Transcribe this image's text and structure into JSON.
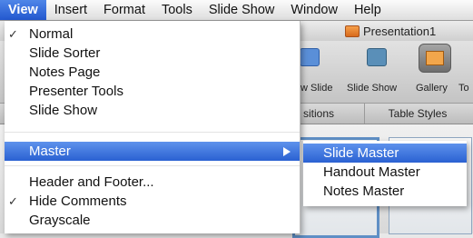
{
  "menubar": {
    "items": [
      "View",
      "Insert",
      "Format",
      "Tools",
      "Slide Show",
      "Window",
      "Help"
    ]
  },
  "app": {
    "document_title": "Presentation1",
    "toolbar": {
      "new_slide_label": "w Slide",
      "slide_show_label": "Slide Show",
      "gallery_label": "Gallery",
      "truncated_label": "To"
    },
    "ribbon_tabs": [
      "sitions",
      "Table Styles"
    ]
  },
  "view_menu": {
    "items": [
      {
        "label": "Normal",
        "checked": "✓"
      },
      {
        "label": "Slide Sorter",
        "checked": ""
      },
      {
        "label": "Notes Page",
        "checked": ""
      },
      {
        "label": "Presenter Tools",
        "checked": ""
      },
      {
        "label": "Slide Show",
        "checked": ""
      },
      {
        "label": "Master",
        "checked": ""
      },
      {
        "label": "Header and Footer...",
        "checked": ""
      },
      {
        "label": "Hide Comments",
        "checked": "✓"
      },
      {
        "label": "Grayscale",
        "checked": ""
      }
    ]
  },
  "master_submenu": {
    "items": [
      "Slide Master",
      "Handout Master",
      "Notes Master"
    ]
  },
  "colors": {
    "highlight": "#2a61d2",
    "menubar": "#dedede"
  }
}
